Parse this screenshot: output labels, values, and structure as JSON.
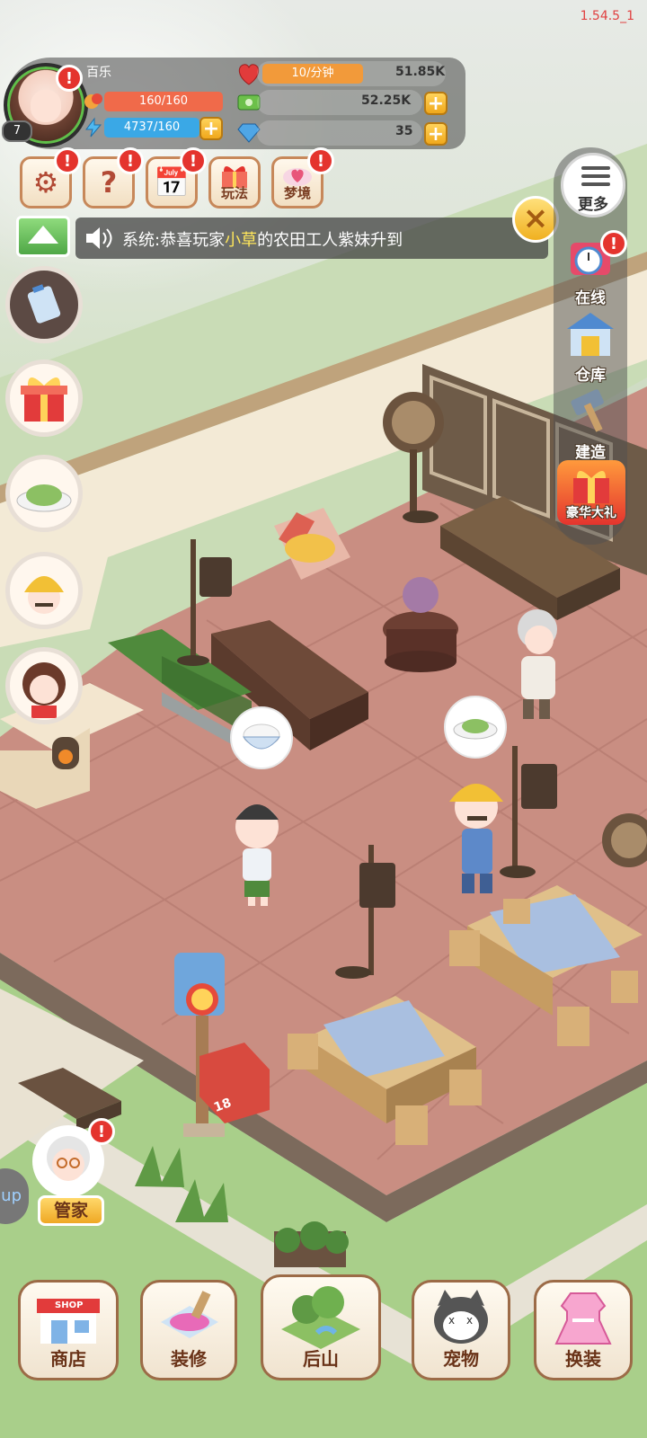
{
  "version": "1.54.5_1",
  "player": {
    "name": "百乐",
    "level": "7",
    "hp": "160/160",
    "energy": "4737/160"
  },
  "resources": {
    "hearts_rate": "10/分钟",
    "hearts": "51.85K",
    "cash": "52.25K",
    "gems": "35"
  },
  "top_buttons": {
    "gameplay": "玩法",
    "dream": "梦境"
  },
  "ticker": {
    "prefix": "系统:恭喜玩家",
    "highlight": "小草",
    "suffix": "的农田工人紫妹升到"
  },
  "right_menu": {
    "more": "更多",
    "online": "在线",
    "warehouse": "仓库",
    "build": "建造",
    "luxury_gift": "豪华大礼"
  },
  "butler": "管家",
  "bottom_nav": {
    "shop": "商店",
    "shop_sign": "SHOP",
    "decorate": "装修",
    "backhill": "后山",
    "pet": "宠物",
    "dressup": "换装"
  },
  "mailbox_number": "18",
  "side_label": "up",
  "colors": {
    "alert": "#e4342e",
    "hp_bar": "#f06a4a",
    "energy_bar": "#3aa8e6",
    "heart_bar": "#f29a3a",
    "floor": "#c98e82",
    "nav_border": "#9c6b47"
  }
}
